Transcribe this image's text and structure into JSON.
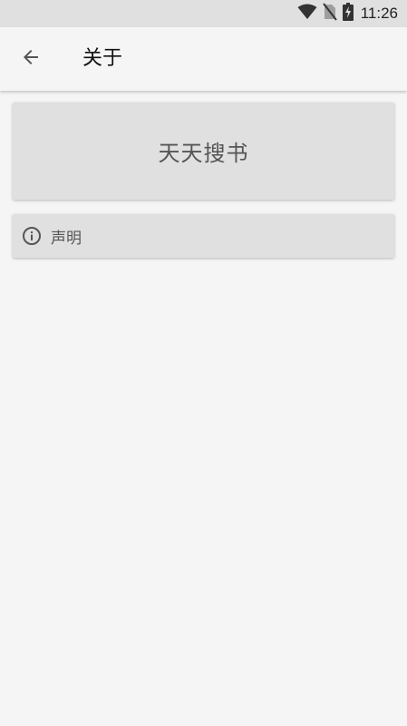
{
  "status_bar": {
    "time": "11:26",
    "icons": [
      "wifi-icon",
      "no-sim-icon",
      "battery-charging-icon"
    ]
  },
  "app_bar": {
    "back_icon": "arrow-back-icon",
    "title": "关于"
  },
  "header_card": {
    "app_name": "天天搜书"
  },
  "items": [
    {
      "icon": "info-icon",
      "label": "声明"
    }
  ],
  "colors": {
    "status_bar_bg": "#e0e0e0",
    "background": "#f5f5f5",
    "card_bg": "#e0e0e0",
    "text_primary": "#111111",
    "text_secondary": "#555555"
  }
}
